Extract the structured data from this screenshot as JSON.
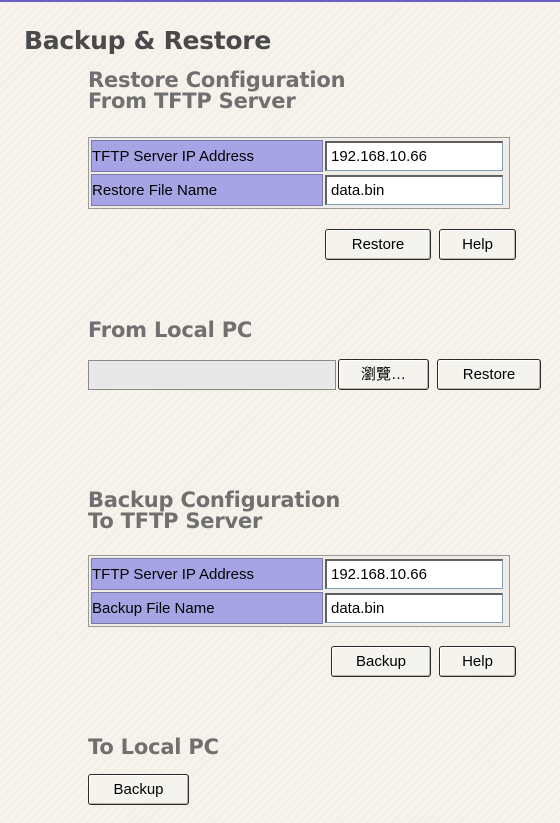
{
  "page": {
    "title": "Backup & Restore"
  },
  "restore_tftp": {
    "title_line1": "Restore Configuration",
    "title_line2": "From TFTP Server",
    "rows": [
      {
        "label": "TFTP Server IP Address",
        "value": "192.168.10.66"
      },
      {
        "label": "Restore File Name",
        "value": "data.bin"
      }
    ],
    "restore_button": "Restore",
    "help_button": "Help"
  },
  "restore_local": {
    "title": "From Local PC",
    "file_value": "",
    "browse_button": "瀏覽…",
    "restore_button": "Restore"
  },
  "backup_tftp": {
    "title_line1": "Backup Configuration",
    "title_line2": "To TFTP Server",
    "rows": [
      {
        "label": "TFTP Server IP Address",
        "value": "192.168.10.66"
      },
      {
        "label": "Backup File Name",
        "value": "data.bin"
      }
    ],
    "backup_button": "Backup",
    "help_button": "Help"
  },
  "backup_local": {
    "title": "To Local PC",
    "backup_button": "Backup"
  },
  "colors": {
    "label_bg": "#a6a4e4",
    "page_bg": "#f7f3ec",
    "top_line": "#6a5ec8"
  }
}
